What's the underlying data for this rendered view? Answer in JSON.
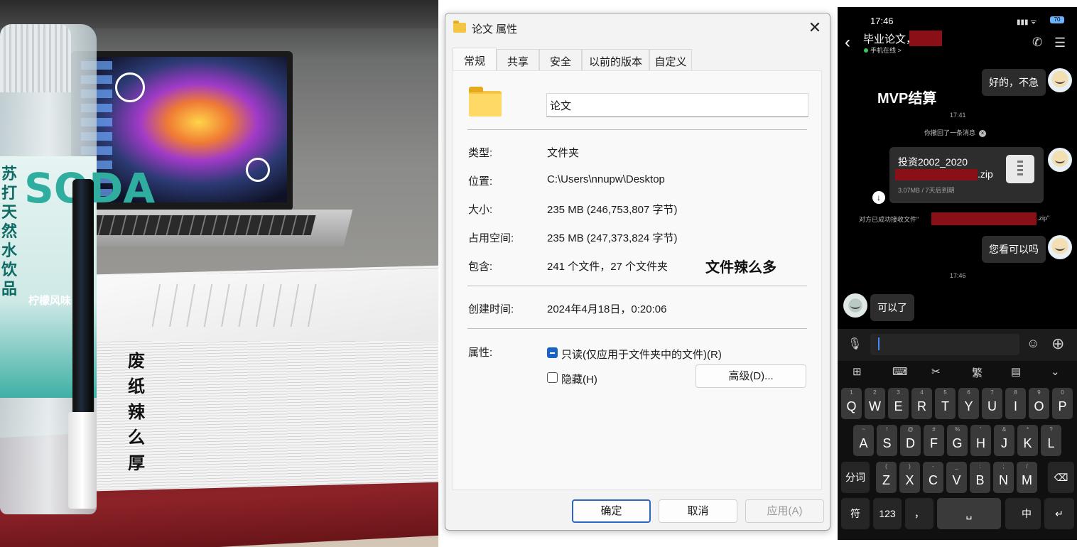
{
  "photo": {
    "vertical_caption": [
      "废",
      "纸",
      "辣",
      "么",
      "厚"
    ],
    "bottle_text": [
      "苏",
      "打",
      "天",
      "然",
      "水",
      "饮",
      "品"
    ],
    "bottle_brand": "SODA",
    "bottle_flavor": "柠檬风味"
  },
  "dialog": {
    "title": "论文 属性",
    "close_icon": "close-icon",
    "tabs": [
      "常规",
      "共享",
      "安全",
      "以前的版本",
      "自定义"
    ],
    "active_tab": "常规",
    "folder_name": "论文",
    "rows": {
      "type_label": "类型:",
      "type_value": "文件夹",
      "location_label": "位置:",
      "location_value": "C:\\Users\\nnupw\\Desktop",
      "size_label": "大小:",
      "size_value": "235 MB (246,753,807 字节)",
      "disk_label": "占用空间:",
      "disk_value": "235 MB (247,373,824 字节)",
      "contains_label": "包含:",
      "contains_value": "241 个文件，27 个文件夹",
      "created_label": "创建时间:",
      "created_value": "2024年4月18日，0:20:06",
      "attr_label": "属性:"
    },
    "overlay_text": "文件辣么多",
    "readonly_label": "只读(仅应用于文件夹中的文件)(R)",
    "readonly_state": "indeterminate",
    "hidden_label": "隐藏(H)",
    "hidden_checked": false,
    "advanced_button": "高级(D)...",
    "ok_button": "确定",
    "cancel_button": "取消",
    "apply_button": "应用(A)"
  },
  "phone": {
    "status_time": "17:46",
    "battery": "70",
    "chat_title": "毕业论文，",
    "online_status": "手机在线 >",
    "messages": {
      "m1": "好的，不急",
      "sticker_text": "MVP结算",
      "ts1": "17:41",
      "recall_notice": "你撤回了一条消息",
      "file_name": "投资2002_2020",
      "file_ext": ".zip",
      "file_meta": "3.07MB / 7天后到期",
      "received_prefix": "对方已成功接收文件\"",
      "received_suffix": ".zip\"",
      "m2": "您看可以吗",
      "ts2": "17:46",
      "m3": "可以了"
    },
    "keyboard": {
      "row1": [
        "Q",
        "W",
        "E",
        "R",
        "T",
        "Y",
        "U",
        "I",
        "O",
        "P"
      ],
      "row1_sub": [
        "1",
        "2",
        "3",
        "4",
        "5",
        "6",
        "7",
        "8",
        "9",
        "0"
      ],
      "row2": [
        "A",
        "S",
        "D",
        "F",
        "G",
        "H",
        "J",
        "K",
        "L"
      ],
      "row2_sub": [
        "~",
        "!",
        "@",
        "#",
        "%",
        "'",
        "&",
        "*",
        "?"
      ],
      "row3": [
        "Z",
        "X",
        "C",
        "V",
        "B",
        "N",
        "M"
      ],
      "row3_sub": [
        "(",
        ")",
        "-",
        "_",
        ":",
        ";",
        "/"
      ],
      "fenci": "分词",
      "fu": "符",
      "num": "123",
      "comma": "，",
      "period": "。",
      "zhong": "中"
    }
  },
  "colors": {
    "redaction": "#8b0f16",
    "accent_blue": "#2b66c7"
  }
}
